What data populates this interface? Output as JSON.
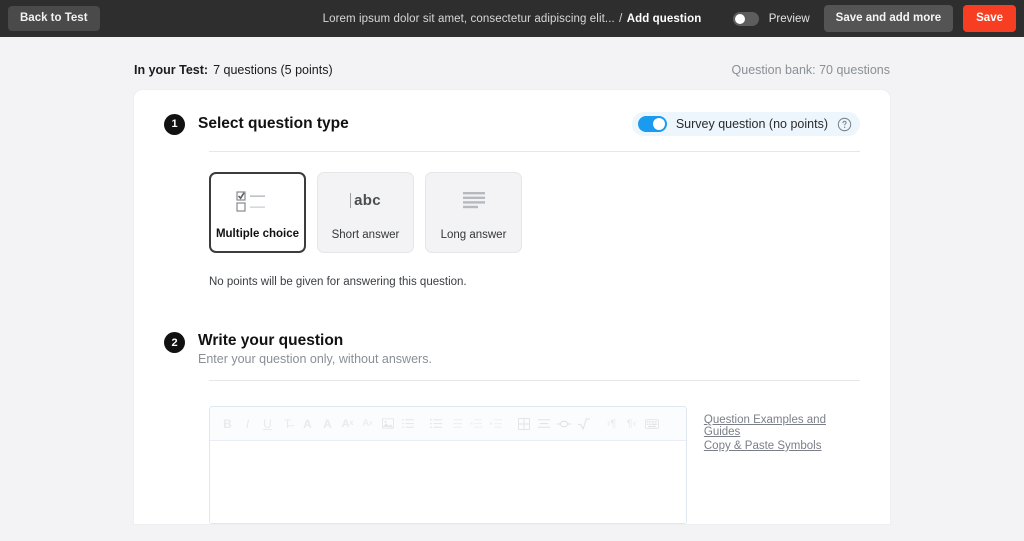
{
  "topbar": {
    "back_label": "Back to Test",
    "breadcrumb_parent": "Lorem ipsum dolor sit amet, consectetur adipiscing elit...",
    "breadcrumb_sep": "/",
    "breadcrumb_current": "Add question",
    "preview_label": "Preview",
    "preview_toggle_state": "off",
    "save_and_add_more_label": "Save and add more",
    "save_label": "Save",
    "save_color": "#f83e22"
  },
  "meta": {
    "in_your_test_label": "In your Test:",
    "in_your_test_value": "7 questions (5 points)",
    "question_bank": "Question bank: 70 questions"
  },
  "step1": {
    "number": "1",
    "title": "Select question type",
    "survey_toggle_state": "on",
    "survey_label": "Survey question (no points)",
    "help_icon": "question-mark-circle-icon",
    "types": [
      {
        "label": "Multiple choice",
        "icon": "checkbox-list-icon",
        "selected": true
      },
      {
        "label": "Short answer",
        "icon": "abc-text-cursor-icon",
        "selected": false
      },
      {
        "label": "Long answer",
        "icon": "paragraph-lines-icon",
        "selected": false
      }
    ],
    "note": "No points will be given for answering this question."
  },
  "step2": {
    "number": "2",
    "title": "Write your question",
    "subtitle": "Enter your question only, without answers.",
    "editor": {
      "value": "",
      "toolbar": [
        {
          "name": "bold-icon",
          "glyph": "B"
        },
        {
          "name": "italic-icon",
          "glyph": "I"
        },
        {
          "name": "underline-icon",
          "glyph": "U"
        },
        {
          "name": "strikethrough-icon",
          "glyph": "T"
        },
        {
          "name": "font-size-increase-icon",
          "glyph": "A"
        },
        {
          "name": "font-size-decrease-icon",
          "glyph": "A"
        },
        {
          "name": "superscript-icon",
          "glyph": "A"
        },
        {
          "name": "subscript-icon",
          "glyph": "A"
        },
        {
          "name": "insert-image-icon",
          "glyph": "img"
        },
        {
          "name": "ordered-list-icon",
          "glyph": "ol"
        },
        {
          "name": "bullet-list-icon",
          "glyph": "ul"
        },
        {
          "name": "numbered-list-icon",
          "glyph": "nl"
        },
        {
          "name": "indent-decrease-icon",
          "glyph": "out"
        },
        {
          "name": "indent-increase-icon",
          "glyph": "in"
        },
        {
          "name": "insert-table-icon",
          "glyph": "tbl"
        },
        {
          "name": "align-icon",
          "glyph": "algn"
        },
        {
          "name": "insert-link-icon",
          "glyph": "link"
        },
        {
          "name": "math-formula-icon",
          "glyph": "sqrt"
        },
        {
          "name": "ltr-direction-icon",
          "glyph": "ltr"
        },
        {
          "name": "rtl-direction-icon",
          "glyph": "rtl"
        },
        {
          "name": "keyboard-icon",
          "glyph": "kbd"
        }
      ]
    },
    "links": [
      "Question Examples and Guides",
      "Copy & Paste Symbols"
    ]
  }
}
